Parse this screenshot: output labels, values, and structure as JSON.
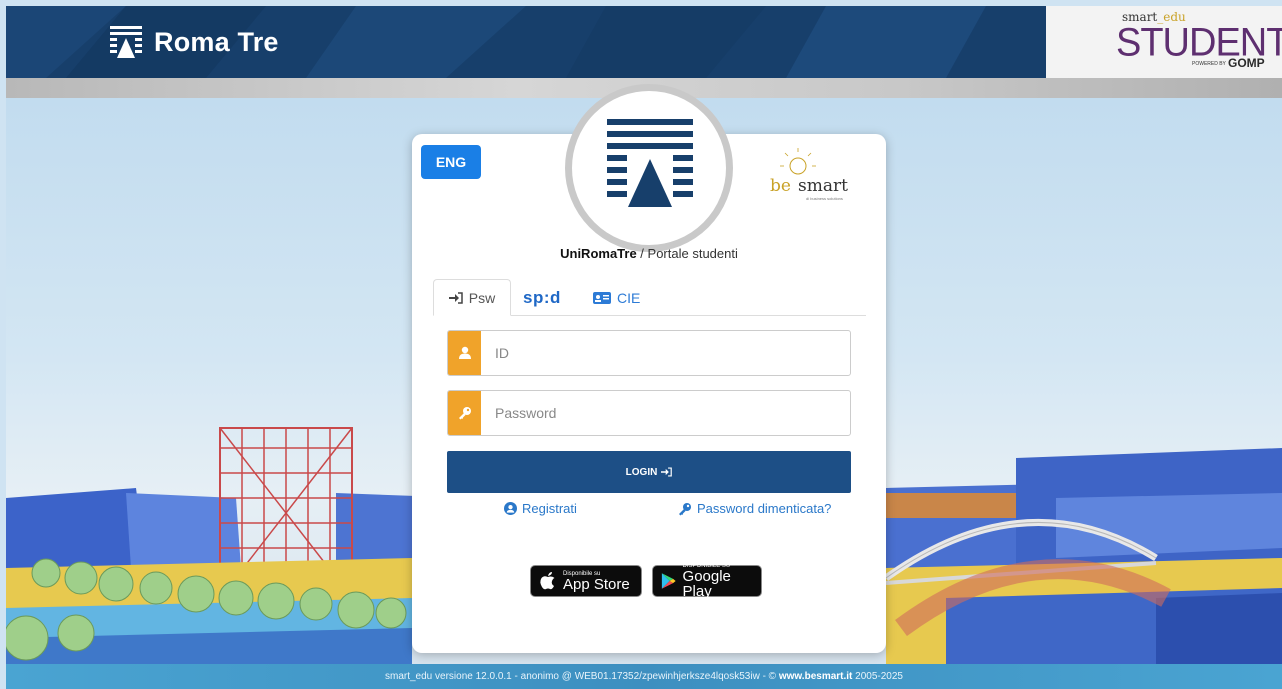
{
  "header": {
    "logo_text": "Roma Tre",
    "studenti": {
      "smart_edu_prefix": "smart",
      "smart_edu_underscore": "_",
      "smart_edu_suffix": "edu",
      "title": "STUDENTI",
      "powered_by": "POWERED BY",
      "gomp": "GOMP"
    }
  },
  "login_card": {
    "lang_button": "ENG",
    "portal_org": "UniRomaTre",
    "portal_sep": " / ",
    "portal_name": "Portale studenti",
    "besmart": {
      "be": "be",
      "smart": "smart",
      "tagline": "di business solutions"
    },
    "tabs": [
      {
        "label": "Psw",
        "active": true
      },
      {
        "label": "sp:d",
        "active": false
      },
      {
        "label": "CIE",
        "active": false
      }
    ],
    "id_field": {
      "placeholder": "ID",
      "value": ""
    },
    "password_field": {
      "placeholder": "Password",
      "value": ""
    },
    "login_button": "LOGIN",
    "register_link": "Registrati",
    "forgot_link": "Password dimenticata?",
    "app_store": {
      "small": "Disponibile su",
      "large": "App Store"
    },
    "google_play": {
      "small": "DISPONIBILE SU",
      "large": "Google Play"
    }
  },
  "footer": {
    "prefix": "smart_edu versione 12.0.0.1 - anonimo @ WEB01.17352/zpewinhjerksze4lqosk53iw - © ",
    "site": "www.besmart.it",
    "suffix": " 2005-2025"
  },
  "colors": {
    "header_bg": "#173f6b",
    "eng_button": "#1a7fe6",
    "field_addon": "#f0a32a",
    "login_button": "#1d4f86",
    "link": "#2a78c9",
    "studenti": "#5e2f70",
    "footer": "#4aa4d2"
  },
  "icons": {
    "id_addon": "user-icon",
    "password_addon": "key-icon",
    "psw_tab": "sign-in-icon",
    "cie_tab": "id-card-icon",
    "register": "user-circle-icon",
    "forgot": "key-icon"
  }
}
